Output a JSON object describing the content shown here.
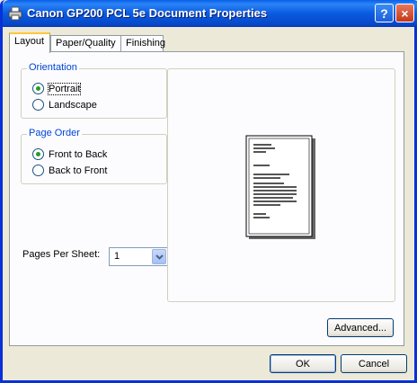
{
  "window": {
    "title": "Canon GP200 PCL 5e Document Properties",
    "icon": "printer-icon"
  },
  "titlebar_buttons": {
    "help": "?",
    "close": "×"
  },
  "tabs": [
    {
      "label": "Layout"
    },
    {
      "label": "Paper/Quality"
    },
    {
      "label": "Finishing"
    }
  ],
  "orientation": {
    "title": "Orientation",
    "options": [
      {
        "label": "Portrait",
        "selected": true
      },
      {
        "label": "Landscape",
        "selected": false
      }
    ]
  },
  "page_order": {
    "title": "Page Order",
    "options": [
      {
        "label": "Front to Back",
        "selected": true
      },
      {
        "label": "Back to Front",
        "selected": false
      }
    ]
  },
  "pages_per_sheet": {
    "label": "Pages Per Sheet:",
    "value": "1"
  },
  "buttons": {
    "advanced": "Advanced...",
    "ok": "OK",
    "cancel": "Cancel"
  },
  "colors": {
    "title_bar": "#0a5ae0",
    "face": "#ece9d8",
    "group_title": "#0046d5"
  }
}
